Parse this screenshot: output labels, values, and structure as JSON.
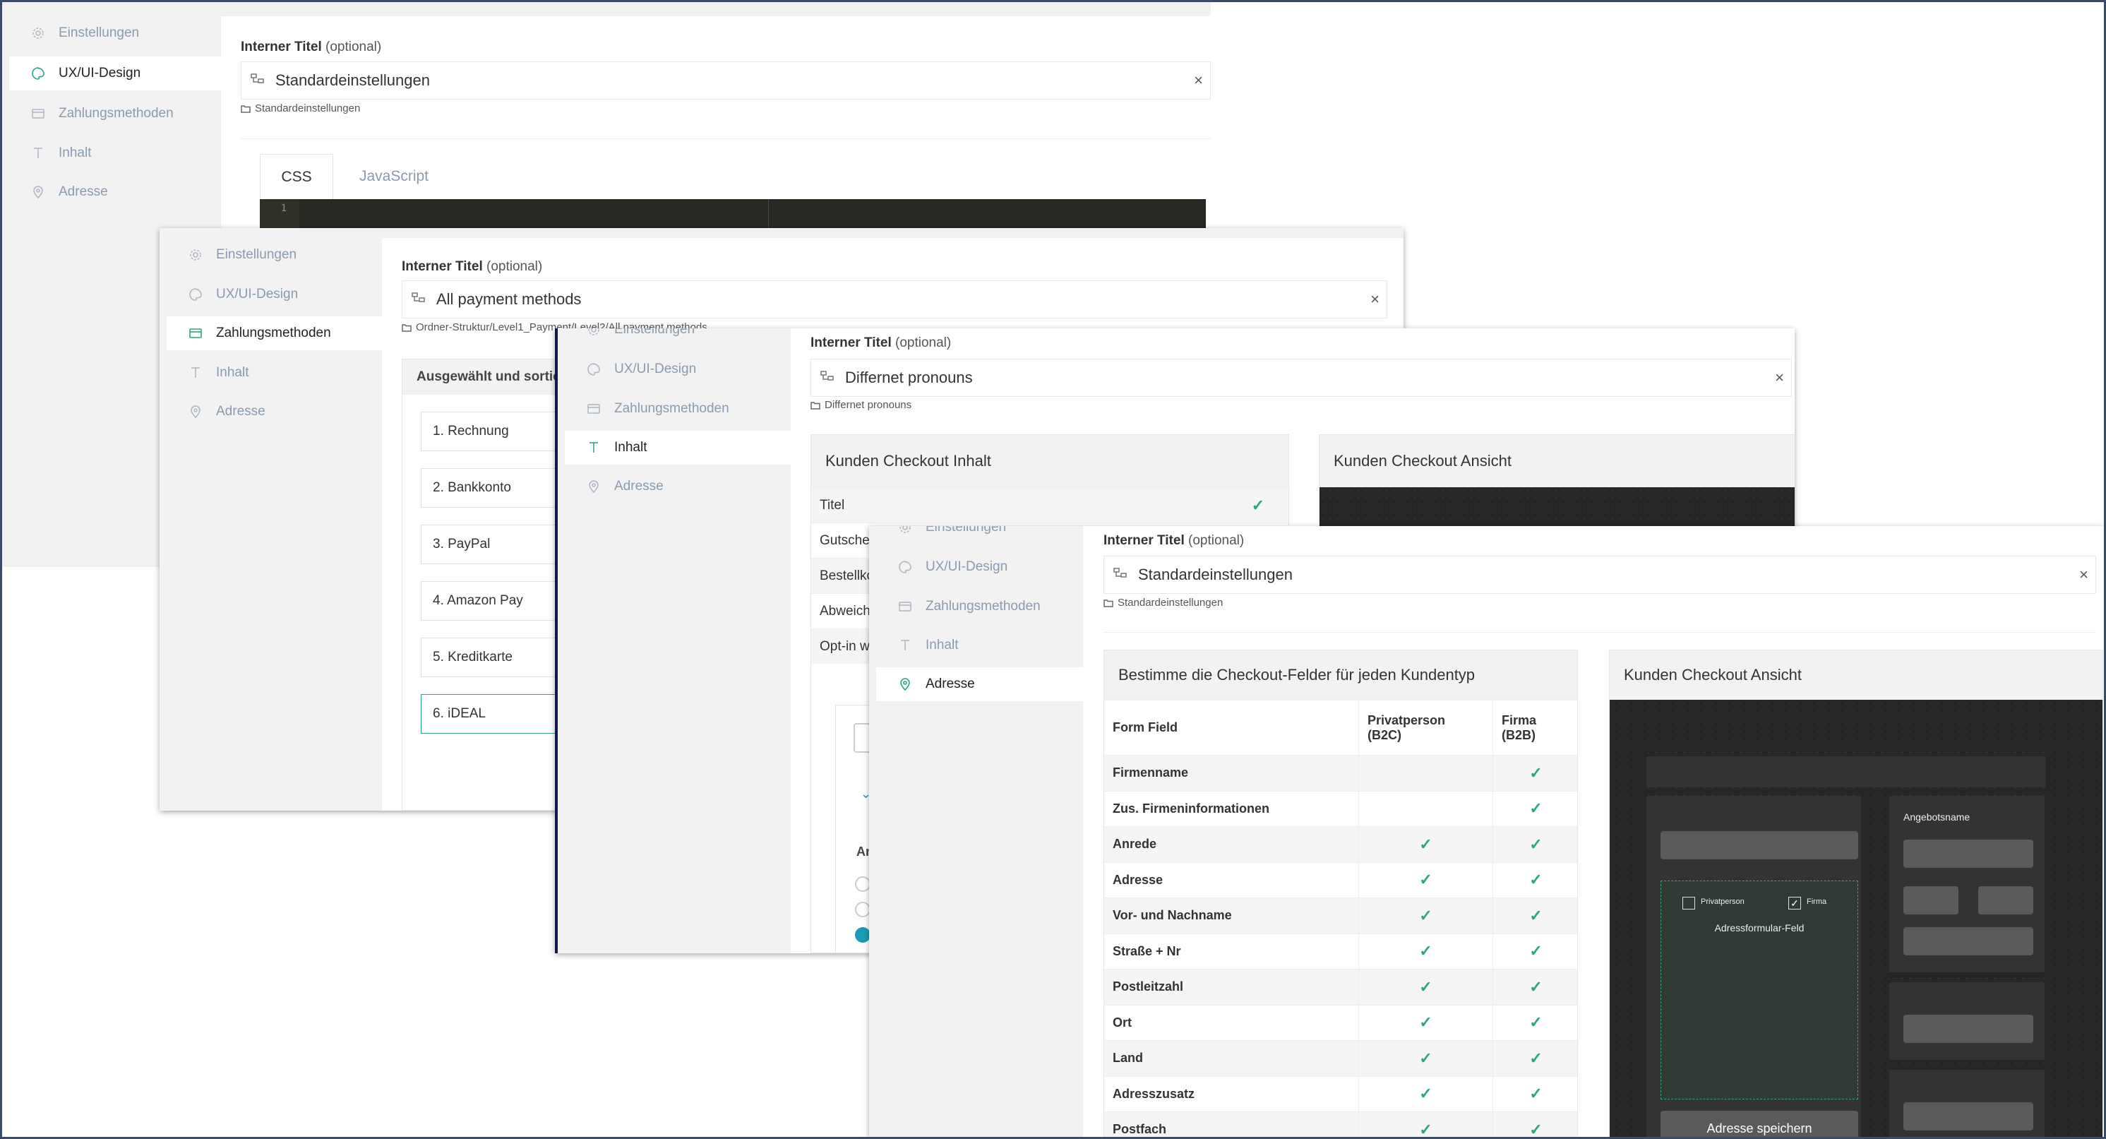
{
  "nav": {
    "einstellungen": "Einstellungen",
    "uxui": "UX/UI-Design",
    "zahlung": "Zahlungsmethoden",
    "inhalt": "Inhalt",
    "adresse": "Adresse"
  },
  "common": {
    "internal_title": "Interner Titel",
    "optional": "(optional)",
    "close": "×"
  },
  "panel1": {
    "title_value": "Standardeinstellungen",
    "folder": "Standardeinstellungen",
    "tabs": [
      "CSS",
      "JavaScript"
    ],
    "line_number": "1"
  },
  "panel2": {
    "title_value": "All payment methods",
    "folder": "Ordner-Struktur/Level1_Payment/Level2/All payment methods",
    "section_head": "Ausgewählt und sortiert",
    "items": [
      "1. Rechnung",
      "2. Bankkonto",
      "3. PayPal",
      "4. Amazon Pay",
      "5. Kreditkarte",
      "6. iDEAL"
    ]
  },
  "panel3": {
    "title_value": "Differnet pronouns",
    "folder": "Differnet pronouns",
    "card_left": "Kunden Checkout Inhalt",
    "card_right": "Kunden Checkout Ansicht",
    "rows": [
      "Titel",
      "Gutschein",
      "Bestellkommentar",
      "Abweichende Adresse",
      "Opt-in w"
    ],
    "partial_label": "An"
  },
  "panel4": {
    "title_value": "Standardeinstellungen",
    "folder": "Standardeinstellungen",
    "card_left": "Bestimme die Checkout-Felder für jeden Kundentyp",
    "card_right": "Kunden Checkout Ansicht",
    "columns": {
      "field": "Form Field",
      "b2c_line1": "Privatperson",
      "b2c_line2": "(B2C)",
      "b2b_line1": "Firma",
      "b2b_line2": "(B2B)"
    },
    "check_mark": "✓",
    "fields": [
      {
        "name": "Firmenname",
        "b2c": false,
        "b2b": true
      },
      {
        "name": "Zus. Firmeninformationen",
        "b2c": false,
        "b2b": true
      },
      {
        "name": "Anrede",
        "b2c": true,
        "b2b": true
      },
      {
        "name": "Adresse",
        "b2c": true,
        "b2b": true
      },
      {
        "name": "Vor- und Nachname",
        "b2c": true,
        "b2b": true
      },
      {
        "name": "Straße + Nr",
        "b2c": true,
        "b2b": true
      },
      {
        "name": "Postleitzahl",
        "b2c": true,
        "b2b": true
      },
      {
        "name": "Ort",
        "b2c": true,
        "b2b": true
      },
      {
        "name": "Land",
        "b2c": true,
        "b2b": true
      },
      {
        "name": "Adresszusatz",
        "b2c": true,
        "b2b": true
      },
      {
        "name": "Postfach",
        "b2c": true,
        "b2b": true
      }
    ],
    "preview": {
      "privatperson": "Privatperson",
      "firma": "Firma",
      "field_label": "Adressformular-Feld",
      "offer_name": "Angebotsname",
      "save": "Adresse speichern"
    }
  },
  "colors": {
    "accent": "#2aa876",
    "sidebar": "#f2f2f2",
    "teal": "#1a9bb5"
  }
}
